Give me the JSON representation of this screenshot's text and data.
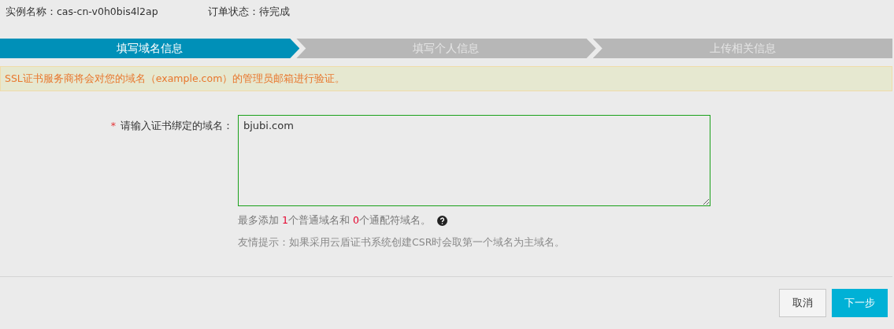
{
  "instance": {
    "label": "实例名称：",
    "value": "cas-cn-v0h0bis4l2ap"
  },
  "order_status": {
    "label": "订单状态：",
    "value": "待完成"
  },
  "steps": [
    {
      "label": "填写域名信息",
      "selected": true
    },
    {
      "label": "填写个人信息",
      "selected": false
    },
    {
      "label": "上传相关信息",
      "selected": false
    }
  ],
  "alert": "SSL证书服务商将会对您的域名（example.com）的管理员邮箱进行验证。",
  "form": {
    "label": "请输入证书绑定的域名：",
    "required_mark": "*",
    "value": "bjubi.com",
    "hint": [
      {
        "kind": "text",
        "text": "最多添加 "
      },
      {
        "kind": "count",
        "text": "1"
      },
      {
        "kind": "text",
        "text": "个普通域名和 "
      },
      {
        "kind": "count",
        "text": "0"
      },
      {
        "kind": "text",
        "text": "个通配符域名。"
      }
    ],
    "tip": "友情提示：如果采用云盾证书系统创建CSR时会取第一个域名为主域名。"
  },
  "buttons": [
    {
      "label": "取消",
      "kind": "secondary"
    },
    {
      "label": "下一步",
      "kind": "primary"
    }
  ]
}
